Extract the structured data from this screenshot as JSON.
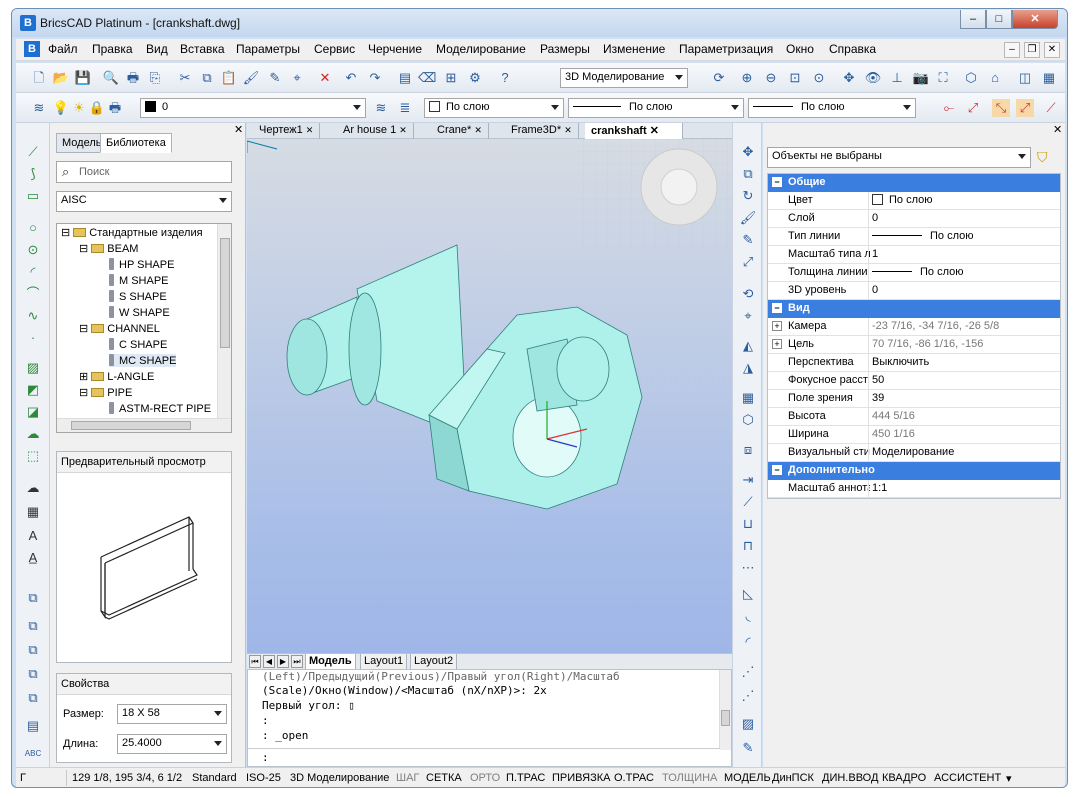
{
  "window": {
    "title": "BricsCAD Platinum - [crankshaft.dwg]"
  },
  "menu": [
    "Файл",
    "Правка",
    "Вид",
    "Вставка",
    "Параметры",
    "Сервис",
    "Черчение",
    "Моделирование",
    "Размеры",
    "Изменение",
    "Параметризация",
    "Окно",
    "Справка"
  ],
  "toolbar": {
    "workspace": "3D Моделирование"
  },
  "layerbar": {
    "layer": "0",
    "color": "По слою",
    "linetype": "По слою",
    "lineweight": "По слою"
  },
  "library": {
    "tabs": [
      "Модель",
      "Библиотека"
    ],
    "search_placeholder": "Поиск",
    "standard": "AISC",
    "tree": [
      "Стандартные изделия",
      "BEAM",
      "HP SHAPE",
      "M SHAPE",
      "S SHAPE",
      "W SHAPE",
      "CHANNEL",
      "C SHAPE",
      "MC SHAPE",
      "L-ANGLE",
      "PIPE",
      "ASTM-RECT PIPE"
    ],
    "preview_title": "Предварительный просмотр",
    "props_title": "Свойства",
    "size_label": "Размер:",
    "size_value": "18 X 58",
    "length_label": "Длина:",
    "length_value": "25.4000"
  },
  "doc_tabs": [
    "Чертеж1",
    "Ar house 1",
    "Crane*",
    "Frame3D*",
    "crankshaft"
  ],
  "layout_tabs": [
    "Модель",
    "Layout1",
    "Layout2"
  ],
  "command": {
    "lines": [
      "(Left)/Предыдущий(Previous)/Правый угол(Right)/Масштаб",
      "(Scale)/Окно(Window)/<Масштаб (nX/nXP)>: 2x",
      "Первый угол: ▯",
      ":",
      ": _open"
    ],
    "prompt": ":"
  },
  "properties": {
    "selection": "Объекты не выбраны",
    "general": "Общие",
    "color_k": "Цвет",
    "color_v": "По слою",
    "layer_k": "Слой",
    "layer_v": "0",
    "linetype_k": "Тип линии",
    "linetype_v": "По слою",
    "ltscale_k": "Масштаб типа л",
    "ltscale_v": "1",
    "lineweight_k": "Толщина линии",
    "lineweight_v": "По слою",
    "elev_k": "3D уровень",
    "elev_v": "0",
    "view": "Вид",
    "camera_k": "Камера",
    "camera_v": "-23 7/16, -34 7/16, -26 5/8",
    "target_k": "Цель",
    "target_v": "70 7/16, -86 1/16, -156",
    "persp_k": "Перспектива",
    "persp_v": "Выключить",
    "focal_k": "Фокусное расст",
    "focal_v": "50",
    "fov_k": "Поле зрения",
    "fov_v": "39",
    "height_k": "Высота",
    "height_v": "444 5/16",
    "width_k": "Ширина",
    "width_v": "450 1/16",
    "vstyle_k": "Визуальный сти",
    "vstyle_v": "Моделирование",
    "extra": "Дополнительно",
    "annoscale_k": "Масштаб аннота",
    "annoscale_v": "1:1"
  },
  "status": {
    "coords": "129 1/8, 195 3/4, 6 1/2",
    "items": [
      "Standard",
      "ISO-25",
      "3D Моделирование",
      "ШАГ",
      "СЕТКА",
      "ОРТО",
      "П.ТРАС",
      "ПРИВЯЗКА",
      "О.ТРАС",
      "ТОЛЩИНА",
      "МОДЕЛЬ",
      "ДинПСК",
      "ДИН.ВВОД",
      "КВАДРО",
      "АССИСТЕНТ"
    ]
  },
  "colors": {
    "accent": "#3a7ee0",
    "model": "#aef0ea",
    "model_dark": "#7fcfcb"
  }
}
